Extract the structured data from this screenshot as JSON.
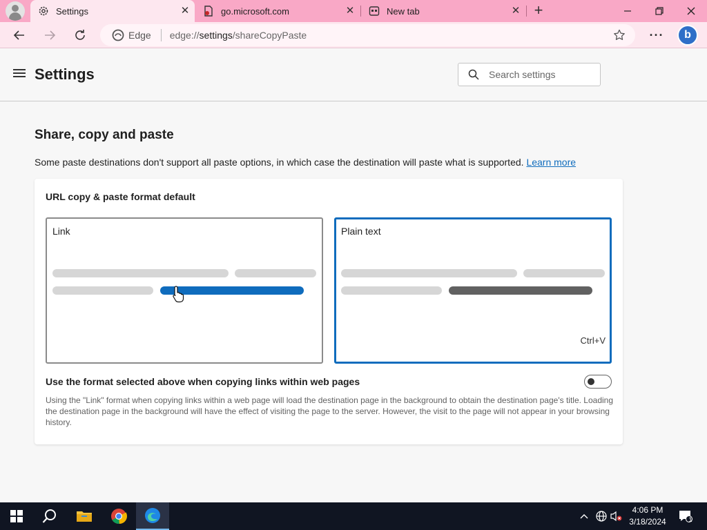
{
  "tabs": [
    {
      "title": "Settings",
      "icon": "gear-icon"
    },
    {
      "title": "go.microsoft.com",
      "icon": "pdf-doc-icon"
    },
    {
      "title": "New tab",
      "icon": "newtab-icon"
    }
  ],
  "address": {
    "browser_label": "Edge",
    "url_host": "edge://",
    "url_path": "settings",
    "url_rest": "/shareCopyPaste"
  },
  "header": {
    "title": "Settings",
    "search_placeholder": "Search settings"
  },
  "section": {
    "title": "Share, copy and paste",
    "description": "Some paste destinations don't support all paste options, in which case the destination will paste what is supported.",
    "learn_more": "Learn more"
  },
  "card": {
    "title": "URL copy & paste format default",
    "options": [
      {
        "label": "Link",
        "selected": false
      },
      {
        "label": "Plain text",
        "selected": true,
        "shortcut": "Ctrl+V"
      }
    ],
    "toggle_label": "Use the format selected above when copying links within web pages",
    "toggle_on": false,
    "toggle_desc": "Using the \"Link\" format when copying links within a web page will load the destination page in the background to obtain the destination page's title. Loading the destination page in the background will have the effect of visiting the page to the server. However, the visit to the page will not appear in your browsing history."
  },
  "taskbar": {
    "time": "4:06 PM",
    "date": "3/18/2024",
    "notification_count": "1"
  },
  "colors": {
    "titlebar": "#f9a8c6",
    "toolbar": "#fde7ef",
    "accent": "#0f6cbd",
    "taskbar": "#101522"
  }
}
